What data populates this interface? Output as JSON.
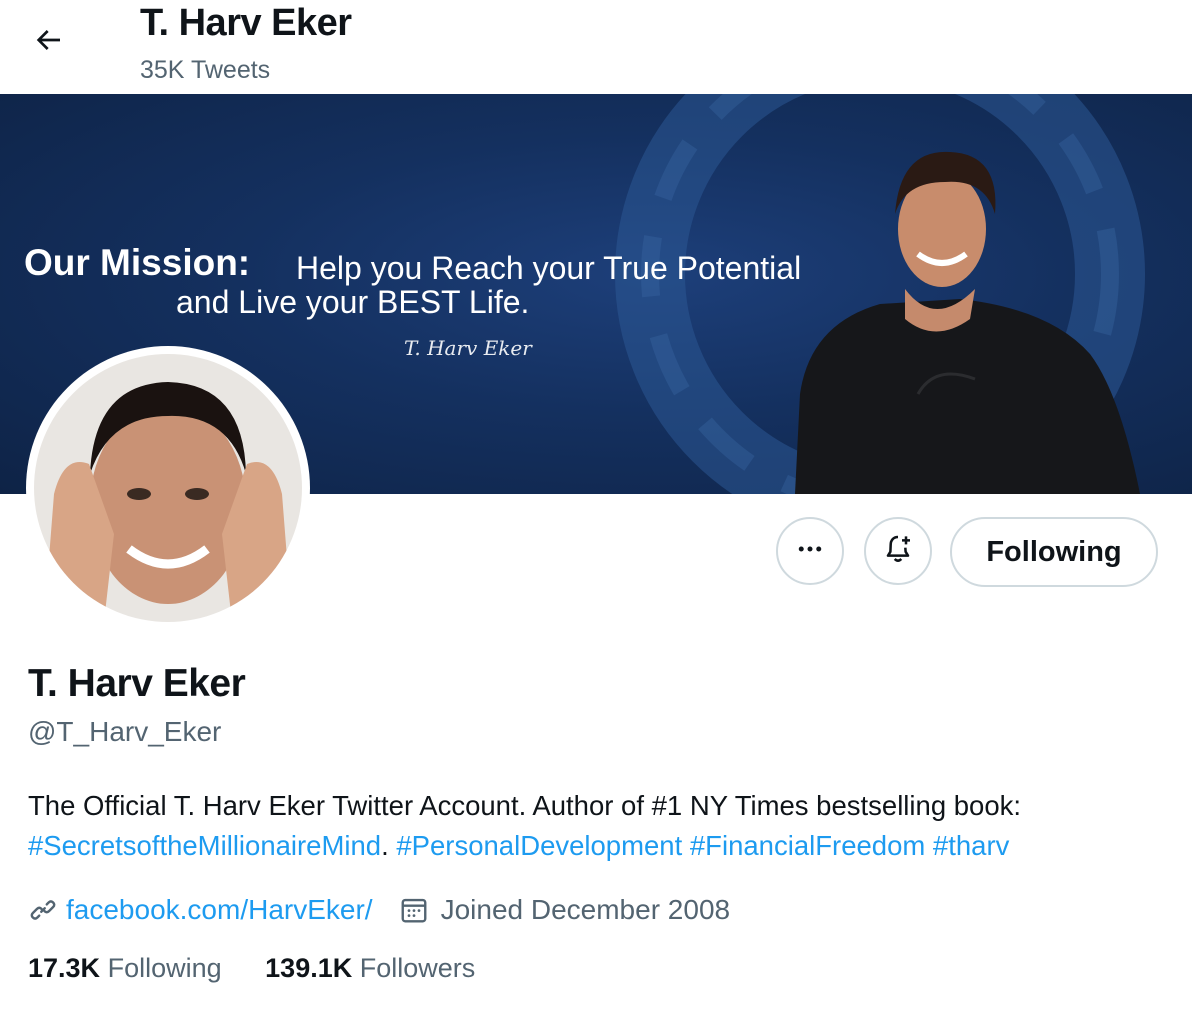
{
  "header": {
    "title": "T. Harv Eker",
    "tweet_count": "35K Tweets"
  },
  "banner": {
    "mission_bold": "Our Mission:",
    "mission_text": "Help you Reach your True Potential",
    "mission_line2": "and Live your BEST Life.",
    "signature": "T. Harv Eker",
    "colors": {
      "background": "#14305f",
      "text": "#ffffff"
    }
  },
  "actions": {
    "more_icon": "more-horizontal-icon",
    "notify_icon": "bell-plus-icon",
    "following_label": "Following"
  },
  "profile": {
    "name": "T. Harv Eker",
    "handle": "@T_Harv_Eker",
    "bio_text": "The Official T. Harv Eker Twitter Account. Author of #1 NY Times bestselling book:",
    "hashtags": [
      "#SecretsoftheMillionaireMind",
      "#PersonalDevelopment",
      "#FinancialFreedom",
      "#tharv"
    ],
    "bio_separator": ".",
    "website": "facebook.com/HarvEker/",
    "joined": "Joined December 2008",
    "following_count": "17.3K",
    "following_label": "Following",
    "followers_count": "139.1K",
    "followers_label": "Followers"
  },
  "colors": {
    "accent": "#1d9bf0",
    "secondary_text": "#536471",
    "primary_text": "#0f1419",
    "border": "#cfd9de"
  }
}
